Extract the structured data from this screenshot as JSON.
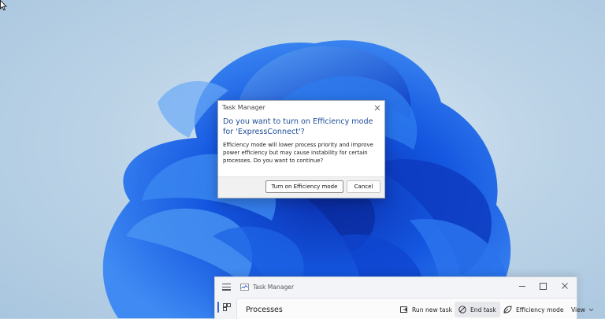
{
  "dialog": {
    "title": "Task Manager",
    "heading": "Do you want to turn on Efficiency mode for 'ExpressConnect'?",
    "body": "Efficiency mode will lower process priority and improve power efficiency but may cause instability for certain processes. Do you want to continue?",
    "confirm_label": "Turn on Efficiency mode",
    "cancel_label": "Cancel",
    "close_icon": "close-icon"
  },
  "task_manager": {
    "title": "Task Manager",
    "page_heading": "Processes",
    "toolbar": {
      "run_new_task": "Run new task",
      "end_task": "End task",
      "efficiency_mode": "Efficiency mode",
      "view": "View"
    }
  },
  "colors": {
    "accent": "#3566c9",
    "dialog_heading": "#1f4e99",
    "wallpaper_bloom": "#1a5fe0"
  }
}
